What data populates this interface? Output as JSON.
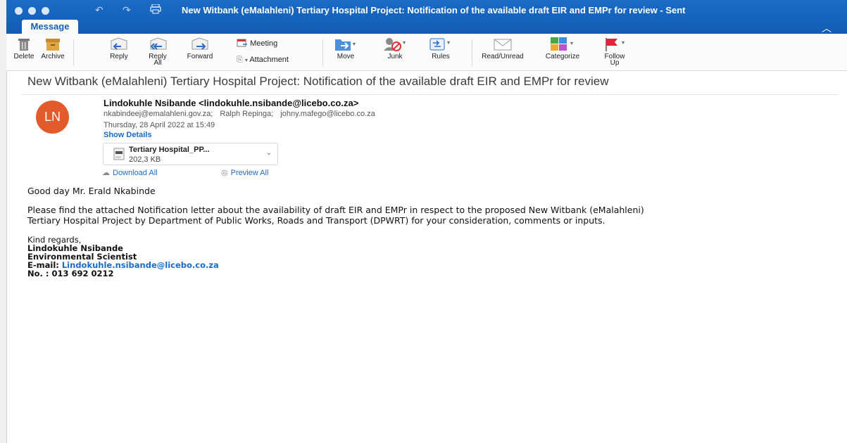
{
  "window": {
    "title": "New Witbank (eMalahleni) Tertiary Hospital Project: Notification of the available draft EIR and EMPr for review - Sent",
    "tab": "Message"
  },
  "ribbon": {
    "delete": "Delete",
    "archive": "Archive",
    "reply": "Reply",
    "reply_all_1": "Reply",
    "reply_all_2": "All",
    "forward": "Forward",
    "meeting": "Meeting",
    "attachment": "Attachment",
    "move": "Move",
    "junk": "Junk",
    "rules": "Rules",
    "read_unread": "Read/Unread",
    "categorize": "Categorize",
    "follow_up_1": "Follow",
    "follow_up_2": "Up"
  },
  "email": {
    "subject": "New Witbank (eMalahleni) Tertiary Hospital Project: Notification of the available draft EIR and EMPr for review",
    "avatar_initials": "LN",
    "sender": "Lindokuhle Nsibande <lindokuhle.nsibande@licebo.co.za>",
    "recipients": [
      "nkabindeej@emalahleni.gov.za;",
      "Ralph Repinga;",
      "johny.mafego@licebo.co.za"
    ],
    "date": "Thursday, 28 April 2022 at 15:49",
    "show_details": "Show Details",
    "attachment_name": "Tertiary Hospital_PP...",
    "attachment_size": "202,3 KB",
    "download_all": "Download All",
    "preview_all": "Preview All",
    "greeting": "Good day Mr. Erald Nkabinde",
    "paragraph_line1": "Please find the attached Notification letter about the availability of draft EIR and EMPr in respect to the proposed New Witbank (eMalahleni)",
    "paragraph_line2": "Tertiary Hospital Project by Department of Public Works, Roads and Transport (DPWRT) for your consideration, comments or inputs.",
    "signature": {
      "closing": "Kind regards,",
      "name": "Lindokuhle Nsibande",
      "role": "Environmental Scientist",
      "email_label": "E-mail: ",
      "email": "Lindokuhle.nsibande@licebo.co.za",
      "phone": "No. : 013 692 0212"
    }
  },
  "colors": {
    "titlebar": "#1a6bc7",
    "avatar": "#e35a2b",
    "link": "#1a6bc7"
  }
}
